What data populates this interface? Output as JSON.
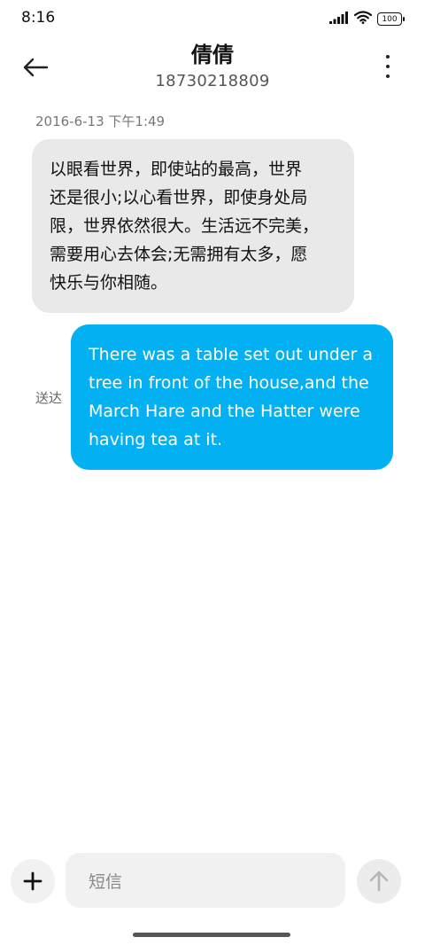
{
  "status_bar": {
    "time": "8:16",
    "battery_level": "100"
  },
  "header": {
    "contact_name": "倩倩",
    "contact_number": "18730218809"
  },
  "conversation": {
    "timestamp": "2016-6-13 下午1:49",
    "incoming_message": {
      "lines": [
        "以眼看世界，即使站的最高，世界",
        "还是很小;以心看世界，即使身处局",
        "限，世界依然很大。生活远不完美，",
        "需要用心去体会;无需拥有太多，愿",
        "快乐与你相随。"
      ]
    },
    "outgoing_message": {
      "lines": [
        "There was a table set out under a",
        "tree in front of the house,and the",
        "March Hare and the Hatter were",
        "having tea at it."
      ],
      "status": "送达"
    }
  },
  "composer": {
    "placeholder": "短信"
  },
  "colors": {
    "outgoing_bubble": "#03b1f3",
    "incoming_bubble": "#e9e9e9"
  }
}
